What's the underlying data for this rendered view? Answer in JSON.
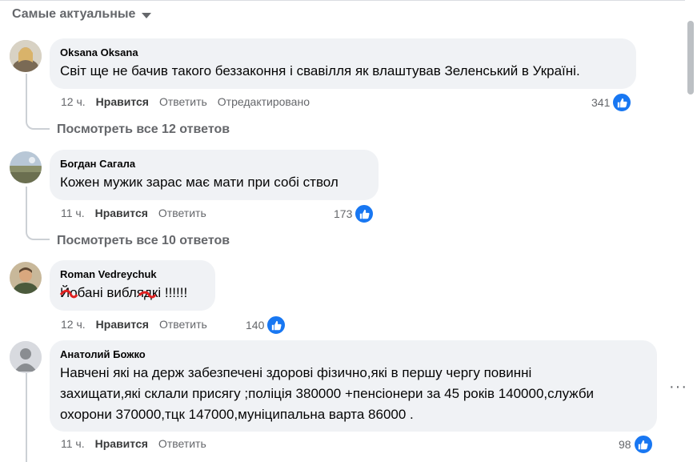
{
  "sort": {
    "label": "Самые актуальные"
  },
  "comments": [
    {
      "author": "Oksana Oksana",
      "text": "Світ ще не бачив такого беззаконня і свавілля як влаштував Зеленський в Україні.",
      "time": "12 ч.",
      "like_label": "Нравится",
      "reply_label": "Ответить",
      "edited_label": "Отредактировано",
      "reactions": "341",
      "view_replies": "Посмотреть все 12 ответов"
    },
    {
      "author": "Богдан Сагала",
      "text": "Кожен мужик зарас має мати при собі ствол",
      "time": "11 ч.",
      "like_label": "Нравится",
      "reply_label": "Ответить",
      "reactions": "173",
      "view_replies": "Посмотреть все 10 ответов"
    },
    {
      "author": "Roman Vedreychuk",
      "text": "Йобані виблядкі !!!!!!",
      "time": "12 ч.",
      "like_label": "Нравится",
      "reply_label": "Ответить",
      "reactions": "140"
    },
    {
      "author": "Анатолий Божко",
      "text_lines": [
        "Навчені які на держ забезпечені здорові фізично,які в першу чергу повинні",
        "захищати,які склали присягу ;поліція 380000 +пенсіонери за 45 років 140000,служби",
        "охорони 370000,тцк 147000,муніципальна варта 86000 ."
      ],
      "time": "11 ч.",
      "like_label": "Нравится",
      "reply_label": "Ответить",
      "reactions": "98"
    }
  ],
  "more_label": "···",
  "icons": {
    "like": "thumbs-up-icon",
    "sort": "caret-down-icon"
  },
  "colors": {
    "accent": "#1877f2",
    "bubble": "#f0f2f5",
    "muted": "#65676b",
    "redact": "#e02020"
  }
}
